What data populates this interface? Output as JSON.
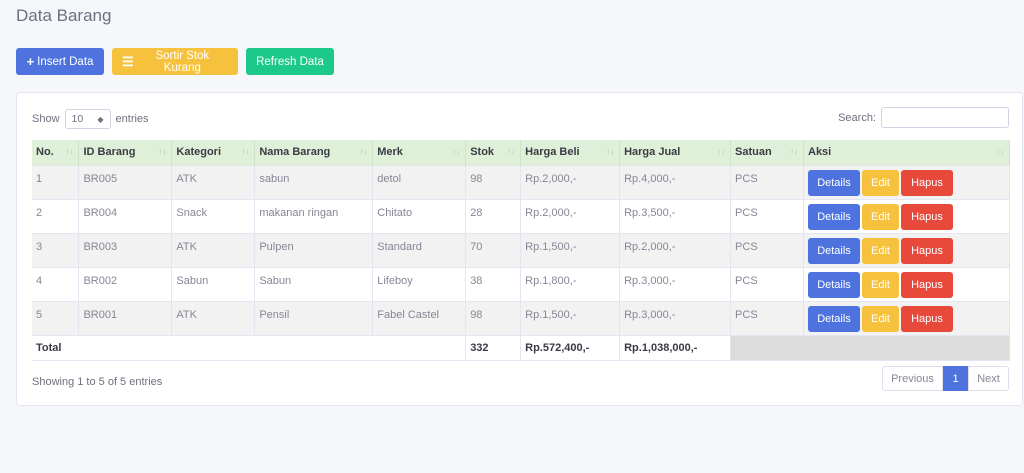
{
  "page": {
    "title": "Data Barang"
  },
  "toolbar": {
    "insert_label": "Insert Data",
    "sort_label": "Sortir Stok Kurang",
    "refresh_label": "Refresh Data"
  },
  "table_controls": {
    "show_label": "Show",
    "entries_value": "10",
    "entries_label": "entries",
    "search_label": "Search:",
    "search_value": ""
  },
  "columns": [
    "No.",
    "ID Barang",
    "Kategori",
    "Nama Barang",
    "Merk",
    "Stok",
    "Harga Beli",
    "Harga Jual",
    "Satuan",
    "Aksi"
  ],
  "rows": [
    [
      "1",
      "BR005",
      "ATK",
      "sabun",
      "detol",
      "98",
      "Rp.2,000,-",
      "Rp.4,000,-",
      "PCS"
    ],
    [
      "2",
      "BR004",
      "Snack",
      "makanan ringan",
      "Chitato",
      "28",
      "Rp.2,000,-",
      "Rp.3,500,-",
      "PCS"
    ],
    [
      "3",
      "BR003",
      "ATK",
      "Pulpen",
      "Standard",
      "70",
      "Rp.1,500,-",
      "Rp.2,000,-",
      "PCS"
    ],
    [
      "4",
      "BR002",
      "Sabun",
      "Sabun",
      "Lifeboy",
      "38",
      "Rp.1,800,-",
      "Rp.3,000,-",
      "PCS"
    ],
    [
      "5",
      "BR001",
      "ATK",
      "Pensil",
      "Fabel Castel",
      "98",
      "Rp.1,500,-",
      "Rp.3,000,-",
      "PCS"
    ]
  ],
  "row_actions": {
    "details": "Details",
    "edit": "Edit",
    "hapus": "Hapus"
  },
  "totals": {
    "label": "Total",
    "stok": "332",
    "harga_beli": "Rp.572,400,-",
    "harga_jual": "Rp.1,038,000,-"
  },
  "footer": {
    "info": "Showing 1 to 5 of 5 entries",
    "previous": "Previous",
    "current_page": "1",
    "next": "Next"
  },
  "colors": {
    "primary": "#4e73df",
    "warning": "#f6c23e",
    "success": "#1cc88a",
    "danger": "#e74a3b",
    "header_bg": "#dff0d8"
  },
  "icons": {
    "insert": "plus-icon",
    "sort": "list-icon",
    "sort_column": "sort-arrows-icon"
  }
}
